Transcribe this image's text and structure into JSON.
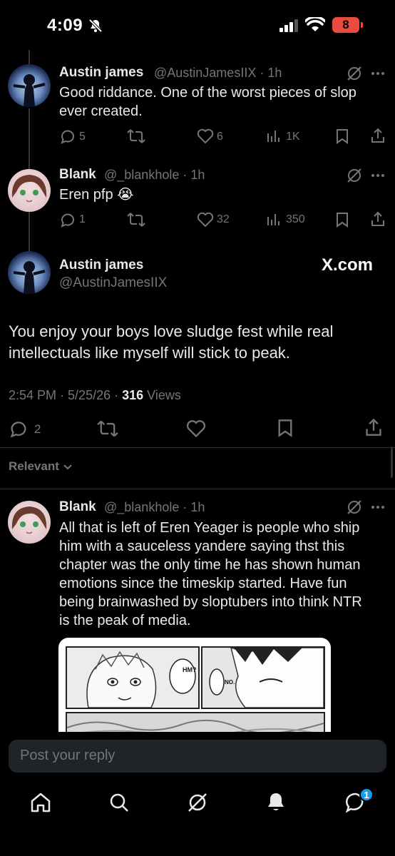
{
  "status_bar": {
    "time": "4:09",
    "battery": "8"
  },
  "thread": [
    {
      "name": "Austin james",
      "handle": "@AustinJamesIIX",
      "time": "1h",
      "text_lines": [
        "Good riddance. One of the worst pieces of slop",
        "ever created."
      ],
      "replies": "5",
      "reposts": "",
      "likes": "6",
      "views": "1K"
    },
    {
      "name": "Blank",
      "handle": "@_blankhole",
      "time": "1h",
      "text": "Eren pfp",
      "emoji": "😭",
      "replies": "1",
      "reposts": "",
      "likes": "32",
      "views": "350"
    }
  ],
  "main_tweet": {
    "name": "Austin james",
    "handle": "@AustinJamesIIX",
    "watermark": "X.com",
    "text_lines": [
      "You enjoy your boys love sludge fest while real",
      "intellectuals like myself will stick to peak."
    ],
    "time": "2:54 PM",
    "date": "5/25/26",
    "views_count": "316",
    "views_label": "Views",
    "replies": "2"
  },
  "sort_label": "Relevant",
  "reply": {
    "name": "Blank",
    "handle": "@_blankhole",
    "time": "1h",
    "text_lines": [
      "All that is left of Eren Yeager is people who ship",
      "him with a sauceless yandere saying thst this",
      "chapter was the only time he has shown human",
      "emotions since the timeskip started. Have fun",
      "being brainwashed by sloptubers into think NTR",
      "is the peak of media."
    ],
    "media_bubbles": [
      "HM?",
      "NO."
    ]
  },
  "reply_placeholder": "Post your reply",
  "nav": {
    "messages_badge": "1"
  },
  "colors": {
    "accent": "#1d9bf0",
    "background": "#000000",
    "muted": "#71767b",
    "battery": "#eb4a3f"
  }
}
